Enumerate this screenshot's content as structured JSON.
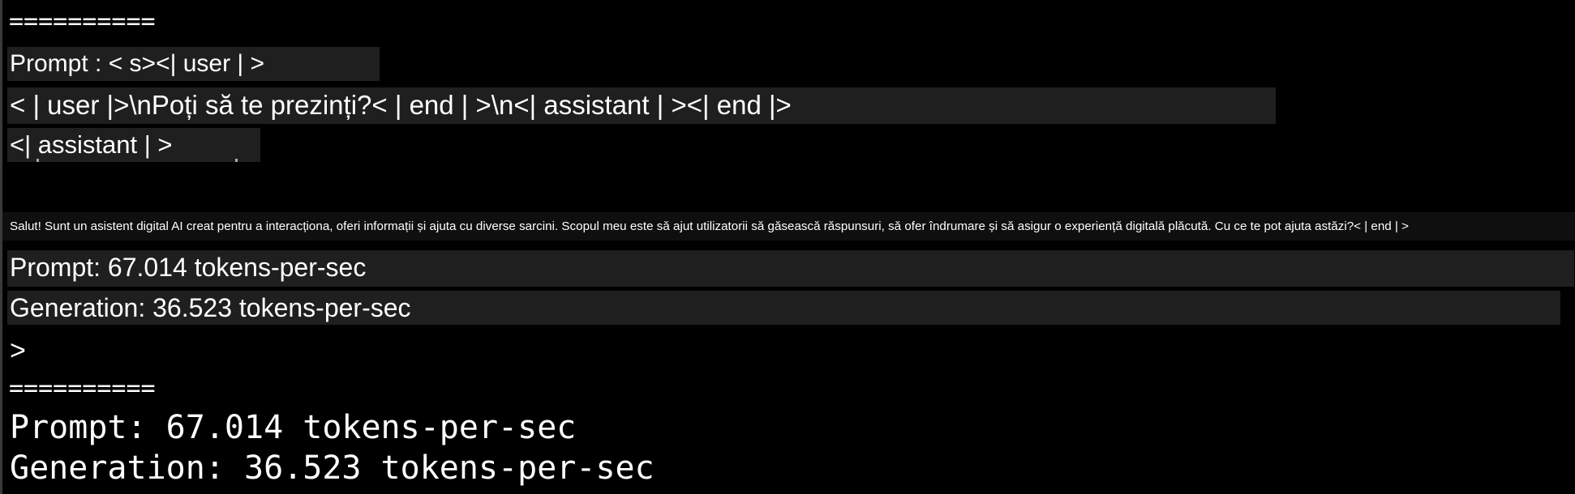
{
  "terminal": {
    "separator_top": "==========",
    "prompt_line_1": "Prompt : < s><| user | >",
    "prompt_line_2": "< | user |>\\nPoți să te prezinți?< | end | >\\n<| assistant | ><| end |>",
    "prompt_line_3": "<| assistant | >",
    "response_text": "Salut! Sunt un asistent digital AI creat pentru a interacționa, oferi informații și ajuta cu diverse sarcini. Scopul meu este să ajut utilizatorii să găsească răspunsuri, să ofer îndrumare și să asigur o experiență digitală plăcută. Cu ce te pot ajuta astăzi?< | end | >",
    "stats_prompt_sans": "Prompt: 67.014 tokens-per-sec",
    "stats_generation_sans": "Generation: 36.523 tokens-per-sec",
    "cursor_prompt": ">",
    "separator_bottom": "==========",
    "stats_prompt_mono": "Prompt: 67.014 tokens-per-sec",
    "stats_generation_mono": "Generation: 36.523 tokens-per-sec"
  },
  "colors": {
    "background": "#000000",
    "text": "#ffffff",
    "highlight_band": "#1f1f1f"
  }
}
